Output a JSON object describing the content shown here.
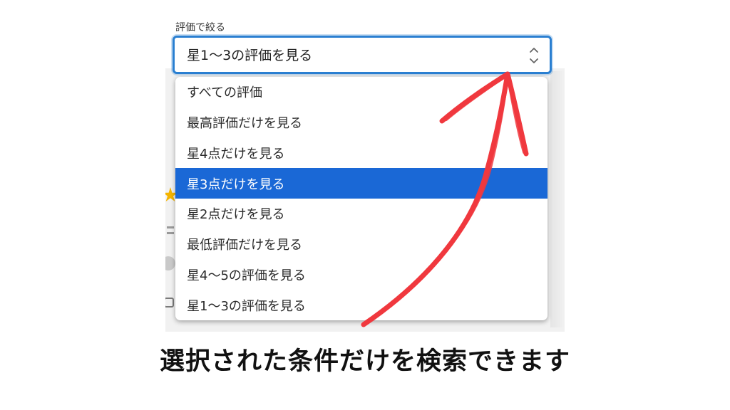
{
  "filter": {
    "label": "評価で絞る",
    "selected_value": "星1～3の評価を見る"
  },
  "dropdown": {
    "options": [
      {
        "label": "すべての評価"
      },
      {
        "label": "最高評価だけを見る"
      },
      {
        "label": "星4点だけを見る"
      },
      {
        "label": "星3点だけを見る",
        "highlighted": true
      },
      {
        "label": "星2点だけを見る"
      },
      {
        "label": "最低評価だけを見る"
      },
      {
        "label": "星4～5の評価を見る"
      },
      {
        "label": "星1～3の評価を見る"
      }
    ]
  },
  "caption": "選択された条件だけを検索できます",
  "colors": {
    "focus_border": "#2a7fd1",
    "highlight": "#1a68d6",
    "annotation_arrow": "#f0383e"
  },
  "icons": {
    "select_chevrons": "up-down-chevron-icon",
    "annotation": "hand-drawn-arrow"
  }
}
